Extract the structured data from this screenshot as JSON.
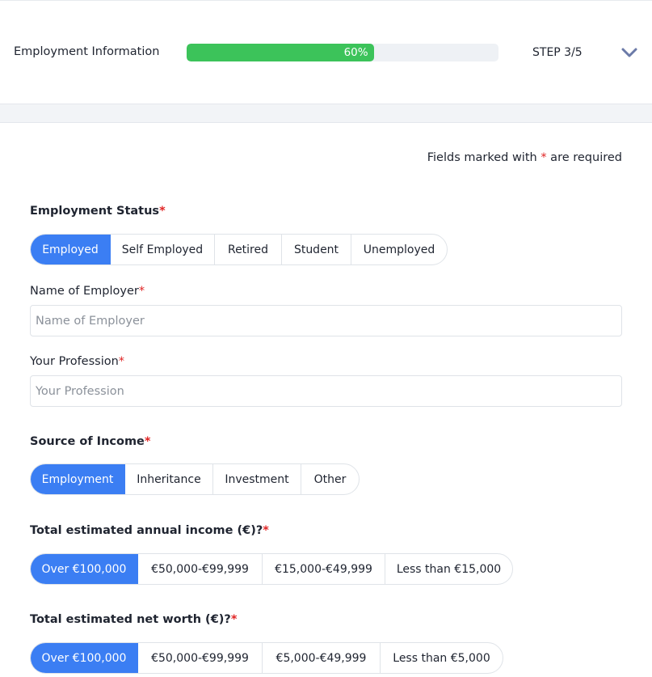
{
  "header": {
    "title": "Employment Information",
    "progress": {
      "value": 60,
      "label": "60%"
    },
    "step": "STEP 3/5",
    "toggle_icon": "chevron-down-icon"
  },
  "form": {
    "required_note": {
      "prefix": "Fields marked with ",
      "star": "*",
      "suffix": " are required"
    },
    "employment_status": {
      "label": "Employment Status",
      "star": "*",
      "options": [
        "Employed",
        "Self Employed",
        "Retired",
        "Student",
        "Unemployed"
      ],
      "selected": "Employed"
    },
    "employer_name": {
      "label": "Name of Employer",
      "star": "*",
      "placeholder": "Name of Employer",
      "value": ""
    },
    "profession": {
      "label": "Your Profession",
      "star": "*",
      "placeholder": "Your Profession",
      "value": ""
    },
    "income_source": {
      "label": "Source of Income",
      "star": "*",
      "options": [
        "Employment",
        "Inheritance",
        "Investment",
        "Other"
      ],
      "selected": "Employment"
    },
    "annual_income": {
      "label": "Total estimated annual income (€)?",
      "star": "*",
      "options": [
        "Over €100,000",
        "€50,000-€99,999",
        "€15,000-€49,999",
        "Less than €15,000"
      ],
      "selected": "Over €100,000"
    },
    "net_worth": {
      "label": "Total estimated net worth (€)?",
      "star": "*",
      "options": [
        "Over €100,000",
        "€50,000-€99,999",
        "€5,000-€49,999",
        "Less than €5,000"
      ],
      "selected": "Over €100,000"
    }
  },
  "colors": {
    "accent": "#3b7ef3",
    "progress": "#3cc35a",
    "required": "#e02424"
  }
}
